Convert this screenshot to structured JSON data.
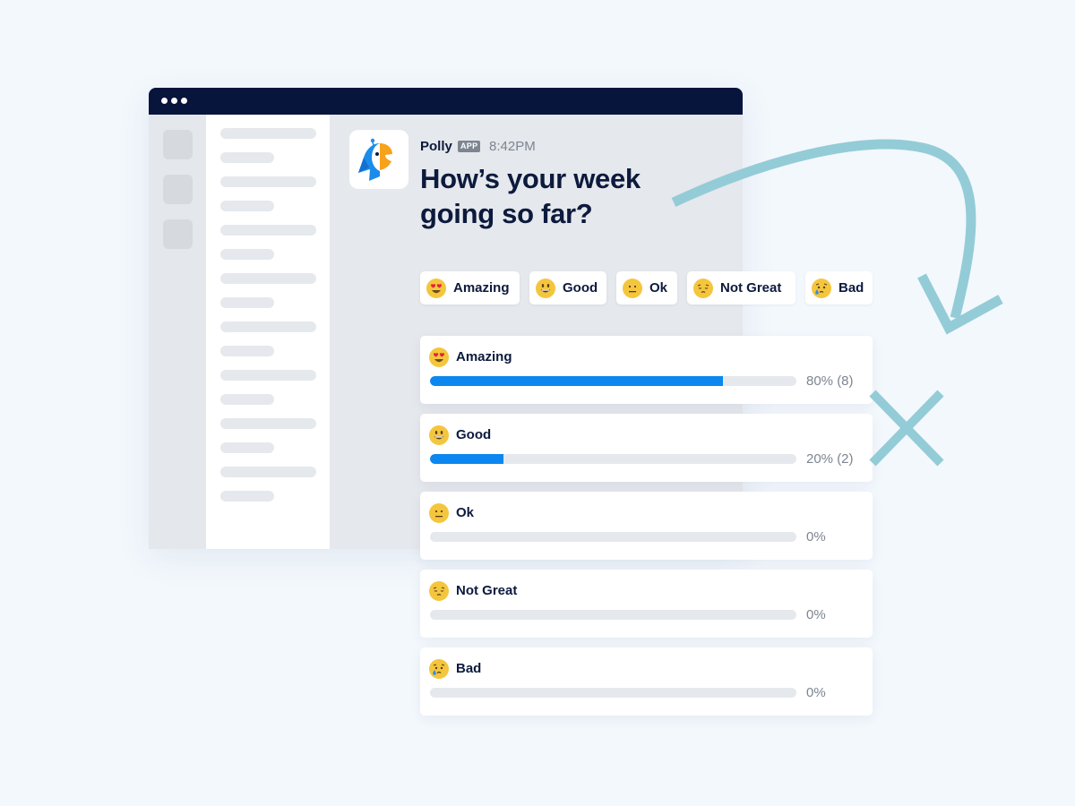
{
  "window": {
    "titlebar_dots": 3,
    "sidebar_placeholder_lines": 16,
    "rail_placeholder_squares": 3
  },
  "message": {
    "sender": "Polly",
    "badge": "APP",
    "time": "8:42PM",
    "question_line1": "How’s your week",
    "question_line2": "going so far?",
    "logo_icon": "parrot-logo-icon"
  },
  "options": [
    {
      "label": "Amazing",
      "icon": "heart-eyes-emoji"
    },
    {
      "label": "Good",
      "icon": "grinning-emoji"
    },
    {
      "label": "Ok",
      "icon": "neutral-face-emoji"
    },
    {
      "label": "Not Great",
      "icon": "pensive-face-emoji"
    },
    {
      "label": "Bad",
      "icon": "crying-face-emoji"
    }
  ],
  "results": [
    {
      "label": "Amazing",
      "percent": 80,
      "count": 8,
      "text": "80% (8)",
      "icon": "heart-eyes-emoji"
    },
    {
      "label": "Good",
      "percent": 20,
      "count": 2,
      "text": "20% (2)",
      "icon": "grinning-emoji"
    },
    {
      "label": "Ok",
      "percent": 0,
      "count": 0,
      "text": "0%",
      "icon": "neutral-face-emoji"
    },
    {
      "label": "Not Great",
      "percent": 0,
      "count": 0,
      "text": "0%",
      "icon": "pensive-face-emoji"
    },
    {
      "label": "Bad",
      "percent": 0,
      "count": 0,
      "text": "0%",
      "icon": "crying-face-emoji"
    }
  ],
  "colors": {
    "titlebar": "#07143b",
    "bar_fill": "#0b87ef",
    "bar_track": "#e5e8ec",
    "text_dark": "#0c1a3d",
    "text_muted": "#7d8591",
    "decoration": "#93ccd7",
    "emoji_yellow": "#f4c63d"
  },
  "decorations": {
    "arrow": "curved-arrow-icon",
    "cross": "x-mark-icon"
  }
}
